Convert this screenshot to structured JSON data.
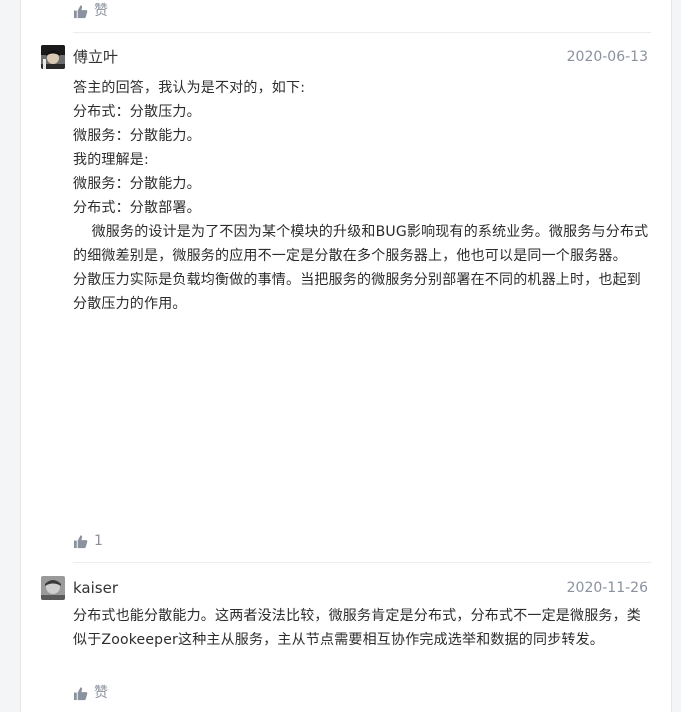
{
  "comments": [
    {
      "likes": "赞"
    },
    {
      "username": "傅立叶",
      "date": "2020-06-13",
      "paragraphs": [
        "答主的回答，我认为是不对的，如下:",
        "",
        "分布式：分散压力。",
        "",
        "微服务：分散能力。",
        "",
        "我的理解是:",
        "",
        "微服务：分散能力。",
        "",
        "分布式：分散部署。",
        "",
        "    微服务的设计是为了不因为某个模块的升级和BUG影响现有的系统业务。微服务与分布式的细微差别是，微服务的应用不一定是分散在多个服务器上，他也可以是同一个服务器。",
        "",
        "",
        "分散压力实际是负载均衡做的事情。当把服务的微服务分别部署在不同的机器上时，也起到分散压力的作用。"
      ],
      "likes": "1"
    },
    {
      "username": "kaiser",
      "date": "2020-11-26",
      "paragraphs": [
        "分布式也能分散能力。这两者没法比较，微服务肯定是分布式，分布式不一定是微服务，类似于Zookeeper这种主从服务，主从节点需要相互协作完成选举和数据的同步转发。"
      ],
      "likes": "赞"
    }
  ],
  "icons": {
    "like": "thumbs-up-icon"
  },
  "colors": {
    "meta": "#8a919f",
    "text": "#2c2c2c",
    "divider": "#ececec"
  }
}
